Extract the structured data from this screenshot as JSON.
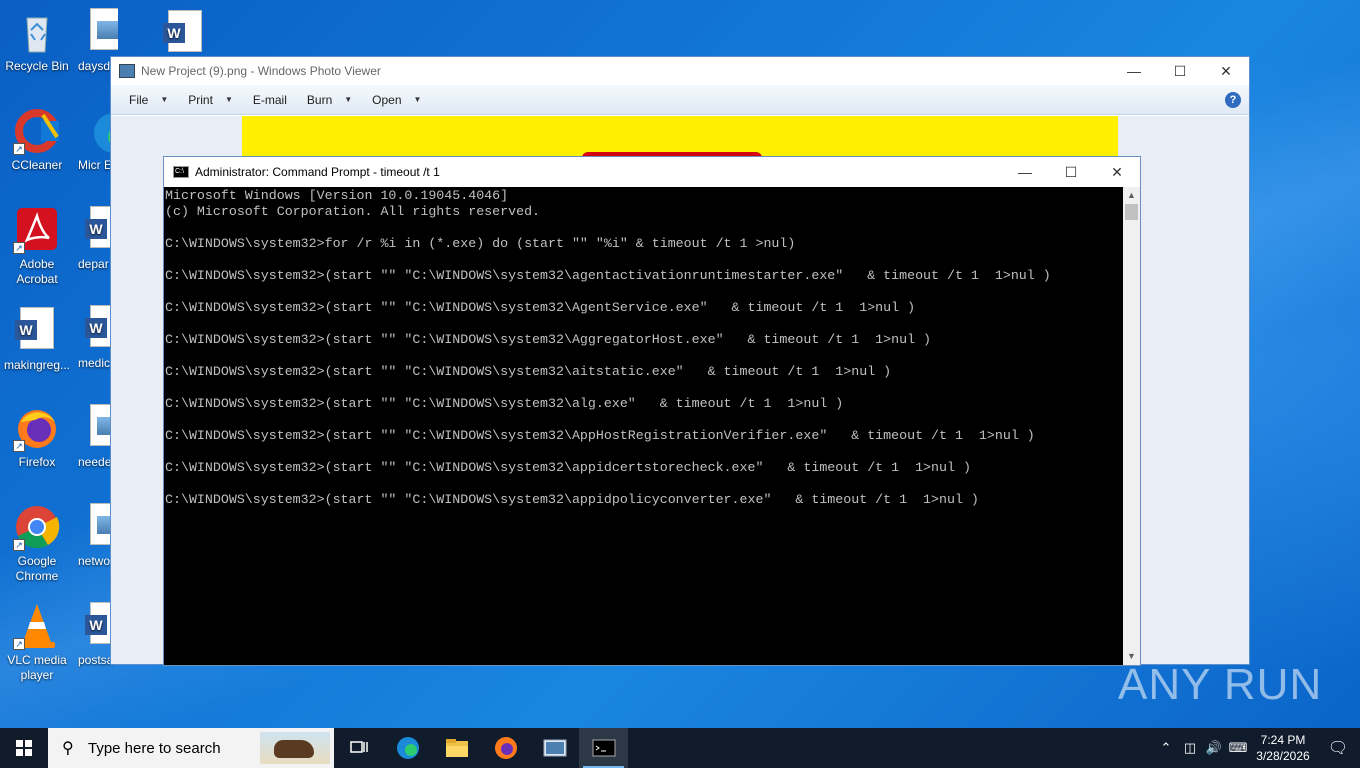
{
  "desktop": {
    "icons": [
      {
        "label": "Recycle Bin",
        "icon": "recycle-bin-icon"
      },
      {
        "label": "CCleaner",
        "icon": "ccleaner-icon"
      },
      {
        "label": "Adobe Acrobat",
        "icon": "adobe-acrobat-icon"
      },
      {
        "label": "makingreg...",
        "icon": "word-document-icon"
      },
      {
        "label": "Firefox",
        "icon": "firefox-icon"
      },
      {
        "label": "Google Chrome",
        "icon": "chrome-icon"
      },
      {
        "label": "VLC media player",
        "icon": "vlc-icon"
      }
    ],
    "partial_icons": [
      {
        "label": "daysdi",
        "icon": "image-file-icon"
      },
      {
        "label": "Micr Ec",
        "icon": "edge-icon"
      },
      {
        "label": "depar",
        "icon": "word-document-icon"
      },
      {
        "label": "medic",
        "icon": "word-document-icon"
      },
      {
        "label": "neede",
        "icon": "image-file-icon"
      },
      {
        "label": "netwo",
        "icon": "image-file-icon"
      },
      {
        "label": "postsa",
        "icon": "word-document-icon"
      },
      {
        "label": "",
        "icon": "word-document-icon"
      }
    ]
  },
  "photo_viewer": {
    "title": "New Project (9).png - Windows Photo Viewer",
    "menu": [
      {
        "label": "File",
        "has_caret": true
      },
      {
        "label": "Print",
        "has_caret": true
      },
      {
        "label": "E-mail",
        "has_caret": false
      },
      {
        "label": "Burn",
        "has_caret": true
      },
      {
        "label": "Open",
        "has_caret": true
      }
    ],
    "image_background": "#ffef00"
  },
  "cmd": {
    "title": "Administrator: Command Prompt - timeout  /t 1",
    "lines": [
      "Microsoft Windows [Version 10.0.19045.4046]",
      "(c) Microsoft Corporation. All rights reserved.",
      "",
      "C:\\WINDOWS\\system32>for /r %i in (*.exe) do (start \"\" \"%i\" & timeout /t 1 >nul)",
      "",
      "C:\\WINDOWS\\system32>(start \"\" \"C:\\WINDOWS\\system32\\agentactivationruntimestarter.exe\"   & timeout /t 1  1>nul )",
      "",
      "C:\\WINDOWS\\system32>(start \"\" \"C:\\WINDOWS\\system32\\AgentService.exe\"   & timeout /t 1  1>nul )",
      "",
      "C:\\WINDOWS\\system32>(start \"\" \"C:\\WINDOWS\\system32\\AggregatorHost.exe\"   & timeout /t 1  1>nul )",
      "",
      "C:\\WINDOWS\\system32>(start \"\" \"C:\\WINDOWS\\system32\\aitstatic.exe\"   & timeout /t 1  1>nul )",
      "",
      "C:\\WINDOWS\\system32>(start \"\" \"C:\\WINDOWS\\system32\\alg.exe\"   & timeout /t 1  1>nul )",
      "",
      "C:\\WINDOWS\\system32>(start \"\" \"C:\\WINDOWS\\system32\\AppHostRegistrationVerifier.exe\"   & timeout /t 1  1>nul )",
      "",
      "C:\\WINDOWS\\system32>(start \"\" \"C:\\WINDOWS\\system32\\appidcertstorecheck.exe\"   & timeout /t 1  1>nul )",
      "",
      "C:\\WINDOWS\\system32>(start \"\" \"C:\\WINDOWS\\system32\\appidpolicyconverter.exe\"   & timeout /t 1  1>nul )"
    ]
  },
  "taskbar": {
    "search_placeholder": "Type here to search",
    "apps": [
      "task-view-icon",
      "edge-icon",
      "file-explorer-icon",
      "firefox-icon",
      "photo-viewer-icon",
      "cmd-icon"
    ],
    "active_app": "cmd-icon",
    "time": "7:24 PM",
    "date": "3/28/2026"
  },
  "watermark": "ANY RUN"
}
